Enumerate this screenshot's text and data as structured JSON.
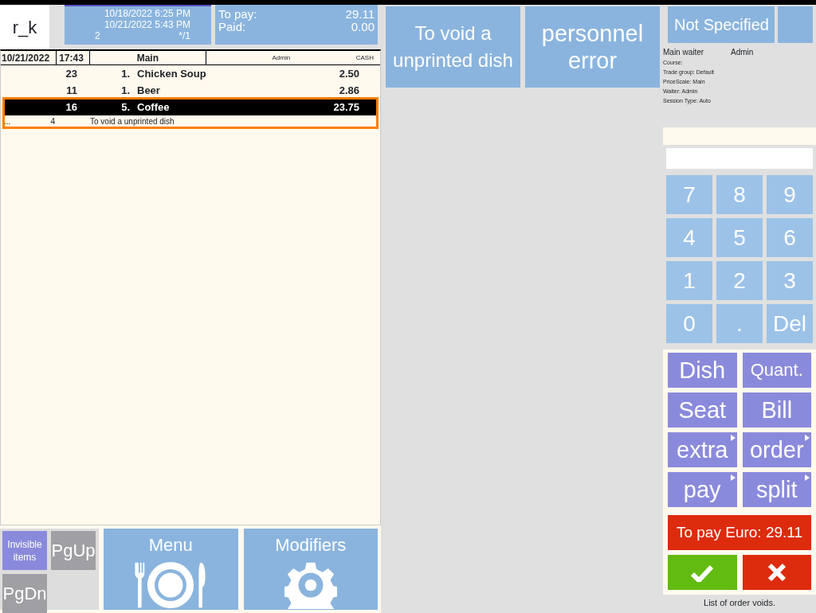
{
  "logo": "r_k",
  "order_info": {
    "opened": "10/18/2022 6:25 PM",
    "updated": "10/21/2022 5:43 PM",
    "guests": "2",
    "table": "*/1"
  },
  "totals": [
    {
      "label": "To pay:",
      "value": "29.11"
    },
    {
      "label": "Paid:",
      "value": "0.00"
    }
  ],
  "order_header": {
    "date": "10/21/2022",
    "time": "17:43",
    "course": "Main",
    "waiter": "Admin",
    "payment": "CASH"
  },
  "dishes": [
    {
      "code": "23",
      "qty": "1.",
      "name": "Chicken Soup",
      "price": "2.50",
      "selected": false
    },
    {
      "code": "11",
      "qty": "1.",
      "name": "Beer",
      "price": "2.86",
      "selected": false
    },
    {
      "code": "16",
      "qty": "5.",
      "name": "Coffee",
      "price": "23.75",
      "selected": true,
      "voids": [
        {
          "mark": "...",
          "qty": "4",
          "reason": "To void a unprinted dish"
        }
      ]
    }
  ],
  "list_buttons": [
    {
      "label": "Invisible items",
      "kind": "toggle"
    },
    {
      "label": "PgUp",
      "kind": "page"
    },
    {
      "label": "PgDn",
      "kind": "page"
    }
  ],
  "big_buttons": [
    {
      "label": "Menu",
      "kind": "menu"
    },
    {
      "label": "Modifiers",
      "kind": "modifiers"
    }
  ],
  "reasons": [
    "To void a unprinted dish",
    "personnel error"
  ],
  "table_status": "Not Specified",
  "main_waiter": {
    "label": "Main waiter",
    "value": "Admin"
  },
  "details": [
    "Course:",
    "Trade group: Default",
    "PriceScale: Main",
    "Waiter: Admin",
    "Session Type: Auto"
  ],
  "keypad": [
    "7",
    "8",
    "9",
    "4",
    "5",
    "6",
    "1",
    "2",
    "3",
    "0",
    ".",
    "Del"
  ],
  "actions": [
    {
      "label": "Dish",
      "submenu": false
    },
    {
      "label": "Quant.",
      "submenu": false
    },
    {
      "label": "Seat",
      "submenu": false
    },
    {
      "label": "Bill",
      "submenu": false
    },
    {
      "label": "extra",
      "submenu": true
    },
    {
      "label": "order",
      "submenu": true
    },
    {
      "label": "pay",
      "submenu": true
    },
    {
      "label": "split",
      "submenu": true
    }
  ],
  "pay_button": "To pay Euro: 29.11",
  "status": "List of order voids."
}
